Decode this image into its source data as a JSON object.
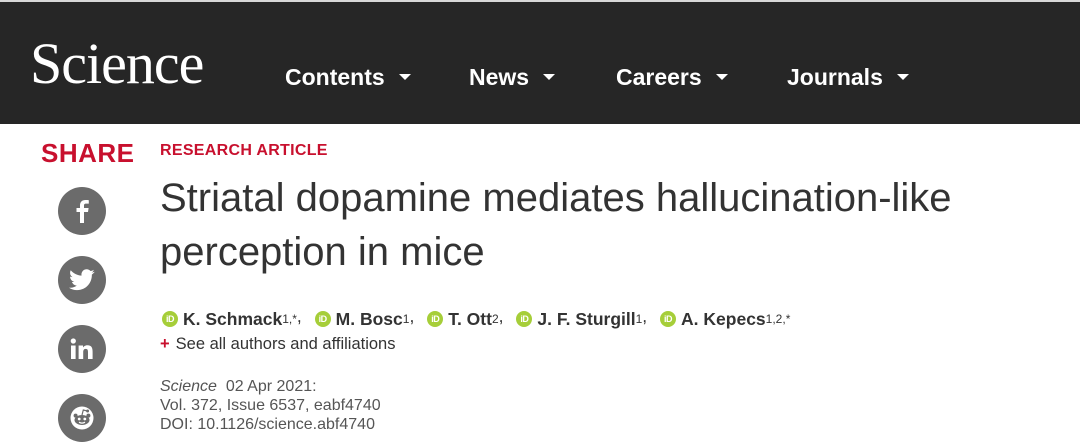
{
  "header": {
    "logo": "Science",
    "nav": [
      {
        "label": "Contents"
      },
      {
        "label": "News"
      },
      {
        "label": "Careers"
      },
      {
        "label": "Journals"
      }
    ]
  },
  "sidebar": {
    "share_label": "SHARE",
    "icons": [
      "facebook-icon",
      "twitter-icon",
      "linkedin-icon",
      "reddit-icon"
    ]
  },
  "article": {
    "type": "RESEARCH ARTICLE",
    "title": "Striatal dopamine mediates hallucination-like perception in mice",
    "authors": [
      {
        "name": "K. Schmack",
        "sup": "1,*"
      },
      {
        "name": "M. Bosc",
        "sup": "1"
      },
      {
        "name": "T. Ott",
        "sup": "2"
      },
      {
        "name": "J. F. Sturgill",
        "sup": "1"
      },
      {
        "name": "A. Kepecs",
        "sup": "1,2,*"
      }
    ],
    "see_all": "See all authors and affiliations",
    "journal": "Science",
    "date": "02 Apr 2021:",
    "volume": "Vol. 372, Issue 6537, eabf4740",
    "doi": "DOI: 10.1126/science.abf4740"
  },
  "colors": {
    "header_bg": "#262626",
    "accent_red": "#c8102e",
    "icon_gray": "#6b6b6b",
    "orcid_green": "#a6ce39"
  }
}
